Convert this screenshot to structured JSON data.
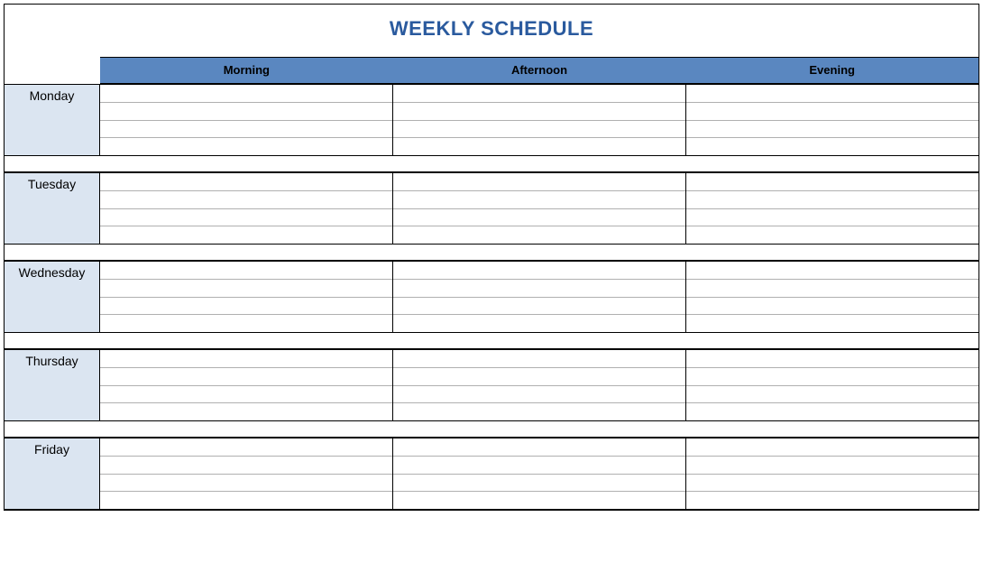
{
  "title": "WEEKLY SCHEDULE",
  "columns": [
    "Morning",
    "Afternoon",
    "Evening"
  ],
  "days": [
    "Monday",
    "Tuesday",
    "Wednesday",
    "Thursday",
    "Friday"
  ],
  "rows_per_cell": 4,
  "colors": {
    "title": "#2a5a9e",
    "header_band": "#5a87c0",
    "day_label_bg": "#dbe5f1"
  }
}
